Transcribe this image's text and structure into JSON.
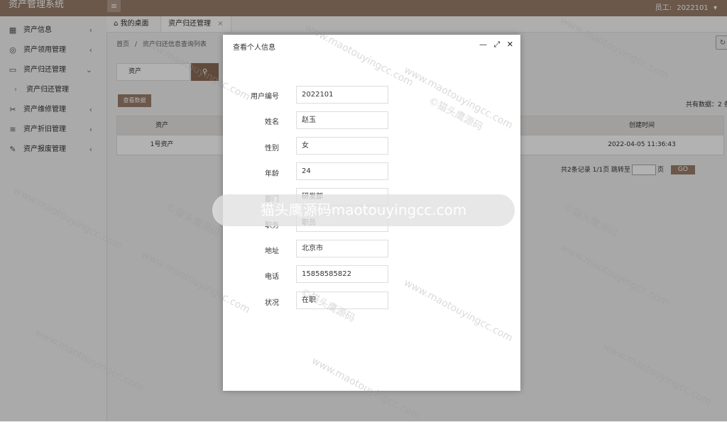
{
  "app": {
    "title": "资产管理系统",
    "menu_icon": "≡"
  },
  "user": {
    "label": "员工:",
    "id": "2022101"
  },
  "sidebar": {
    "items": [
      {
        "label": "资产信息",
        "icon": "calendar-icon"
      },
      {
        "label": "资产领用管理",
        "icon": "check-circle-icon"
      },
      {
        "label": "资产归还管理",
        "icon": "image-icon",
        "expanded": true
      },
      {
        "label": "资产维修管理",
        "icon": "tools-icon"
      },
      {
        "label": "资产折旧管理",
        "icon": "layers-icon"
      },
      {
        "label": "资产报废管理",
        "icon": "wrench-icon"
      }
    ],
    "subitem": "资产归还管理"
  },
  "tabs": {
    "home": "我的桌面",
    "active": "资产归还管理"
  },
  "breadcrumb": {
    "home": "首页",
    "sep": "/",
    "current": "资产归还信息查询列表"
  },
  "search": {
    "value": "资产"
  },
  "toolbar": {
    "view_data": "查看数据",
    "total": "共有数据：2 条"
  },
  "table": {
    "headers": {
      "asset": "资产",
      "created": "创建时间"
    },
    "row": {
      "asset": "1号资产",
      "created": "2022-04-05 11:36:43"
    }
  },
  "pager": {
    "summary": "共2条记录  1/1页  跳转至",
    "page_suffix": "页",
    "go": "GO"
  },
  "modal": {
    "title": "查看个人信息",
    "fields": [
      {
        "label": "用户编号",
        "value": "2022101"
      },
      {
        "label": "姓名",
        "value": "赵玉"
      },
      {
        "label": "性别",
        "value": "女"
      },
      {
        "label": "年龄",
        "value": "24"
      },
      {
        "label": "部门",
        "value": "研发部"
      },
      {
        "label": "职务",
        "value": "职员"
      },
      {
        "label": "地址",
        "value": "北京市"
      },
      {
        "label": "电话",
        "value": "15858585822"
      },
      {
        "label": "状况",
        "value": "在职"
      }
    ]
  },
  "watermark": {
    "bar": "猫头鹰源码maotouyingcc.com",
    "diagonal": "www.maotouyingcc.com",
    "brand": "©猫头鹰源码"
  }
}
